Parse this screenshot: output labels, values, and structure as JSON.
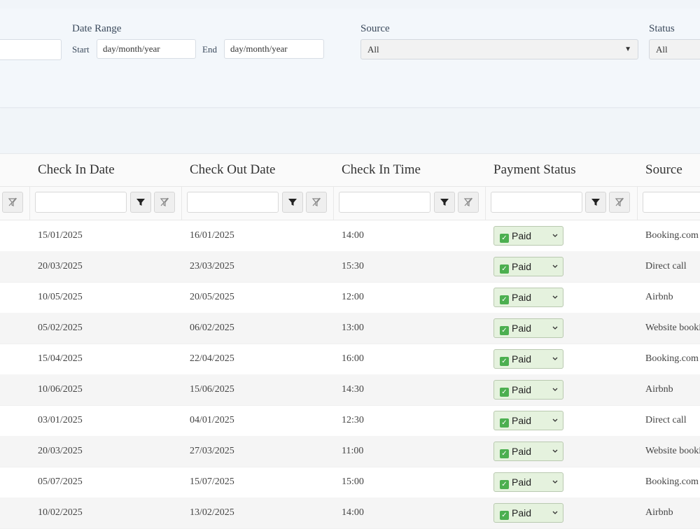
{
  "filters": {
    "date_range": {
      "label": "Date Range",
      "start_label": "Start",
      "start_placeholder": "day/month/year",
      "end_label": "End",
      "end_placeholder": "day/month/year"
    },
    "source": {
      "label": "Source",
      "selected": "All"
    },
    "status": {
      "label": "Status",
      "selected": "All"
    }
  },
  "table": {
    "columns": [
      "Check In Date",
      "Check Out Date",
      "Check In Time",
      "Payment Status",
      "Source"
    ],
    "rows": [
      {
        "check_in": "15/01/2025",
        "check_out": "16/01/2025",
        "time": "14:00",
        "payment": "Paid",
        "source": "Booking.com"
      },
      {
        "check_in": "20/03/2025",
        "check_out": "23/03/2025",
        "time": "15:30",
        "payment": "Paid",
        "source": "Direct call"
      },
      {
        "check_in": "10/05/2025",
        "check_out": "20/05/2025",
        "time": "12:00",
        "payment": "Paid",
        "source": "Airbnb"
      },
      {
        "check_in": "05/02/2025",
        "check_out": "06/02/2025",
        "time": "13:00",
        "payment": "Paid",
        "source": "Website booking"
      },
      {
        "check_in": "15/04/2025",
        "check_out": "22/04/2025",
        "time": "16:00",
        "payment": "Paid",
        "source": "Booking.com"
      },
      {
        "check_in": "10/06/2025",
        "check_out": "15/06/2025",
        "time": "14:30",
        "payment": "Paid",
        "source": "Airbnb"
      },
      {
        "check_in": "03/01/2025",
        "check_out": "04/01/2025",
        "time": "12:30",
        "payment": "Paid",
        "source": "Direct call"
      },
      {
        "check_in": "20/03/2025",
        "check_out": "27/03/2025",
        "time": "11:00",
        "payment": "Paid",
        "source": "Website booking"
      },
      {
        "check_in": "05/07/2025",
        "check_out": "15/07/2025",
        "time": "15:00",
        "payment": "Paid",
        "source": "Booking.com"
      },
      {
        "check_in": "10/02/2025",
        "check_out": "13/02/2025",
        "time": "14:00",
        "payment": "Paid",
        "source": "Airbnb"
      }
    ]
  },
  "colors": {
    "paid_bg": "#e5f2de",
    "row_alt_bg": "#f5f5f5",
    "panel_bg": "#f3f7fb"
  }
}
